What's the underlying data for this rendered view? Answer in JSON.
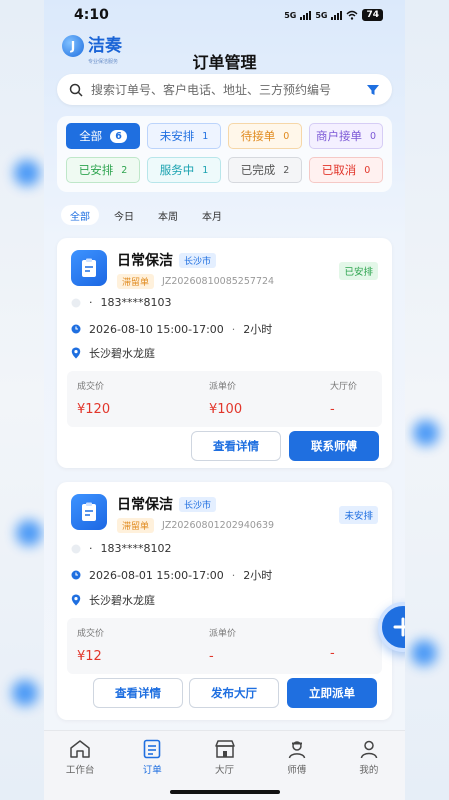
{
  "status_bar": {
    "time": "4:10",
    "net1": "5G",
    "net2": "5G",
    "battery": "74"
  },
  "header": {
    "logo_text": "洁奏",
    "logo_sub": "专业保洁服务",
    "title": "订单管理"
  },
  "search": {
    "placeholder": "搜索订单号、客户电话、地址、三方预约编号"
  },
  "status_filters": [
    {
      "label": "全部",
      "count": "6",
      "border": "#1f6fe0",
      "bg": "#1f6fe0",
      "color": "#ffffff"
    },
    {
      "label": "未安排",
      "count": "1",
      "border": "#bcd4fb",
      "bg": "#eef4ff",
      "color": "#1f6fe0"
    },
    {
      "label": "待接单",
      "count": "0",
      "border": "#f6d7a8",
      "bg": "#fff7ea",
      "color": "#e08a1e"
    },
    {
      "label": "商户接单",
      "count": "0",
      "border": "#d6cdf5",
      "bg": "#f4f0ff",
      "color": "#7b57d6"
    },
    {
      "label": "已安排",
      "count": "2",
      "border": "#bfe7c9",
      "bg": "#effaf2",
      "color": "#2ea44f"
    },
    {
      "label": "服务中",
      "count": "1",
      "border": "#b8e6ea",
      "bg": "#eefafb",
      "color": "#1aa2b0"
    },
    {
      "label": "已完成",
      "count": "2",
      "border": "#d6d9de",
      "bg": "#f4f5f7",
      "color": "#555555"
    },
    {
      "label": "已取消",
      "count": "0",
      "border": "#f5c9c6",
      "bg": "#fff1f0",
      "color": "#e2362b"
    }
  ],
  "time_tabs": [
    "全部",
    "今日",
    "本周",
    "本月"
  ],
  "orders": [
    {
      "service": "日常保洁",
      "city": "长沙市",
      "type": "滞留单",
      "order_no": "JZ20260810085257724",
      "status": "已安排",
      "phone": "183****8103",
      "time": "2026-08-10 15:00-17:00",
      "duration": "2小时",
      "address": "长沙碧水龙庭",
      "deal_label": "成交价",
      "deal_value": "¥120",
      "dispatch_label": "派单价",
      "dispatch_value": "¥100",
      "hall_label": "大厅价",
      "hall_value": "-",
      "buttons": [
        "查看详情",
        "联系师傅"
      ]
    },
    {
      "service": "日常保洁",
      "city": "长沙市",
      "type": "滞留单",
      "order_no": "JZ20260801202940639",
      "status": "未安排",
      "phone": "183****8102",
      "time": "2026-08-01 15:00-17:00",
      "duration": "2小时",
      "address": "长沙碧水龙庭",
      "deal_label": "成交价",
      "deal_value": "¥12",
      "dispatch_label": "派单价",
      "dispatch_value": "-",
      "hall_value": "-",
      "buttons": [
        "查看详情",
        "发布大厅",
        "立即派单"
      ]
    }
  ],
  "bottom_nav": [
    {
      "label": "工作台",
      "icon": "home-icon"
    },
    {
      "label": "订单",
      "icon": "order-list-icon"
    },
    {
      "label": "大厅",
      "icon": "shop-icon"
    },
    {
      "label": "师傅",
      "icon": "worker-icon"
    },
    {
      "label": "我的",
      "icon": "user-icon"
    }
  ],
  "colors": {
    "primary": "#1f6fe0",
    "price_red": "#e2362b",
    "assigned_green": "#2ea44f"
  }
}
